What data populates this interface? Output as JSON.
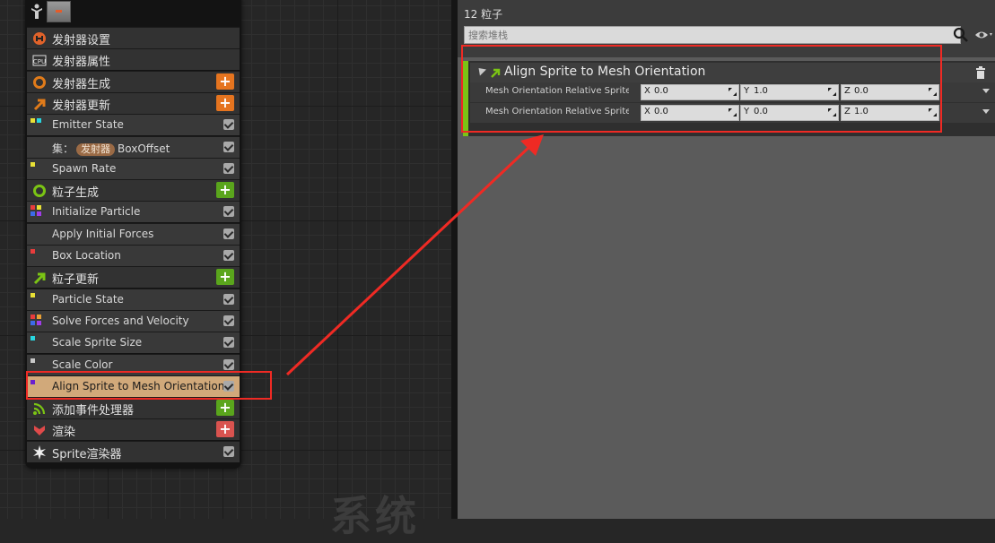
{
  "node": {
    "rows": [
      {
        "kind": "stage",
        "label": "发射器设置",
        "icon": "emitter-settings-icon",
        "icon_color": "#e0622a"
      },
      {
        "kind": "stage",
        "label": "发射器属性",
        "icon": "cpu-icon",
        "icon_text": "CPU"
      },
      {
        "kind": "stage",
        "label": "发射器生成",
        "icon": "emitter-spawn-icon",
        "icon_color": "#e07b1a",
        "add": "#e5741f"
      },
      {
        "kind": "stage",
        "label": "发射器更新",
        "icon": "emitter-update-icon",
        "icon_color": "#e07b1a",
        "add": "#e5741f"
      },
      {
        "kind": "module",
        "label": "Emitter State",
        "dots": [
          "#e8e035",
          "#28d6e0"
        ],
        "check": true
      },
      {
        "kind": "set",
        "prefix": "集：",
        "pill": "发射器",
        "label": "BoxOffset",
        "check": true
      },
      {
        "kind": "module",
        "label": "Spawn Rate",
        "dots": [
          "#e8e035"
        ],
        "check": true
      },
      {
        "kind": "stage",
        "label": "粒子生成",
        "icon": "particle-spawn-icon",
        "icon_color": "#7bc414",
        "add": "#5aa51c"
      },
      {
        "kind": "module",
        "label": "Initialize Particle",
        "dots": [
          "#e83c3c",
          "#e8e035",
          "#3c6ae8",
          "#a03ce8"
        ],
        "check": true
      },
      {
        "kind": "module",
        "label": "Apply Initial Forces",
        "dots": [],
        "check": true
      },
      {
        "kind": "module",
        "label": "Box Location",
        "dots": [
          "#e83c3c"
        ],
        "check": true
      },
      {
        "kind": "stage",
        "label": "粒子更新",
        "icon": "particle-update-icon",
        "icon_color": "#7bc414",
        "add": "#5aa51c"
      },
      {
        "kind": "module",
        "label": "Particle State",
        "dots": [
          "#e8e035"
        ],
        "check": true
      },
      {
        "kind": "module",
        "label": "Solve Forces and Velocity",
        "dots": [
          "#e83c3c",
          "#e8a035",
          "#3c6ae8",
          "#a03ce8"
        ],
        "check": true
      },
      {
        "kind": "module",
        "label": "Scale Sprite Size",
        "dots": [
          "#28d6e0"
        ],
        "check": true
      },
      {
        "kind": "module",
        "label": "Scale Color",
        "dots": [
          "#c8c8c8"
        ],
        "check": true
      },
      {
        "kind": "module",
        "label": "Align Sprite to Mesh Orientation",
        "dots": [
          "#6a1fd0"
        ],
        "check": true,
        "selected": true
      },
      {
        "kind": "stage",
        "label": "添加事件处理器",
        "icon": "event-handler-icon",
        "icon_color": "#7bc414",
        "add": "#5aa51c"
      },
      {
        "kind": "stage",
        "label": "渲染",
        "icon": "render-icon",
        "icon_color": "#e04a4a",
        "add": "#d9534f"
      },
      {
        "kind": "stage",
        "label": "Sprite渲染器",
        "icon": "sprite-renderer-icon",
        "icon_color": "#f0f0f0",
        "check": true
      }
    ]
  },
  "watermark": "系统",
  "panel": {
    "particle_count": "12 粒子",
    "search_placeholder": "搜索堆栈",
    "module_title": "Align Sprite to Mesh Orientation",
    "properties": [
      {
        "label": "Mesh Orientation Relative Sprite",
        "x": "0.0",
        "y": "1.0",
        "z": "0.0"
      },
      {
        "label": "Mesh Orientation Relative Sprite",
        "x": "0.0",
        "y": "0.0",
        "z": "1.0"
      }
    ],
    "axis_labels": [
      "X",
      "Y",
      "Z"
    ]
  },
  "colors": {
    "accent": "#7bc414",
    "selected_row": "#d1a97a",
    "annotation": "#ef2a24"
  }
}
